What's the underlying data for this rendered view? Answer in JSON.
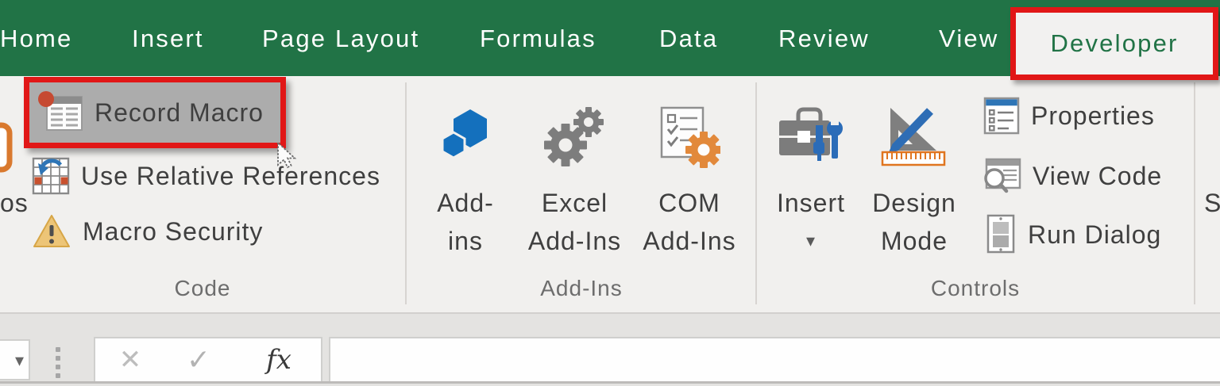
{
  "tabs": {
    "items": [
      "Home",
      "Insert",
      "Page Layout",
      "Formulas",
      "Data",
      "Review",
      "View",
      "Developer"
    ],
    "active": "Developer"
  },
  "ribbon": {
    "groups": [
      {
        "name": "Code",
        "buttons": [
          {
            "label": "Record Macro",
            "state": "highlighted"
          },
          {
            "label": "Use Relative References"
          },
          {
            "label": "Macro Security"
          }
        ]
      },
      {
        "name": "Add-Ins",
        "buttons": [
          {
            "line1": "Add-",
            "line2": "ins"
          },
          {
            "line1": "Excel",
            "line2": "Add-Ins"
          },
          {
            "line1": "COM",
            "line2": "Add-Ins"
          }
        ]
      },
      {
        "name": "Controls",
        "buttons": [
          {
            "label": "Insert",
            "has_dropdown": true
          },
          {
            "line1": "Design",
            "line2": "Mode"
          },
          {
            "label": "Properties"
          },
          {
            "label": "View Code"
          },
          {
            "label": "Run Dialog"
          }
        ]
      }
    ],
    "clipped_left_button_fragment": "os",
    "clipped_right_button_fragment": "S"
  },
  "formula_bar": {
    "name_box_value": "",
    "formula_value": "",
    "insert_function_label": "fx"
  },
  "icons": {
    "dropdown_arrow": "▾",
    "cancel": "✕",
    "enter": "✓"
  },
  "annotations": {
    "highlight_color": "#e11717",
    "highlighted_tab": "Developer",
    "highlighted_button": "Record Macro"
  },
  "colors": {
    "ribbon_green": "#217346",
    "ribbon_background": "#f1f0ee",
    "active_button_background": "#acacac",
    "active_tab_text": "#217346"
  }
}
